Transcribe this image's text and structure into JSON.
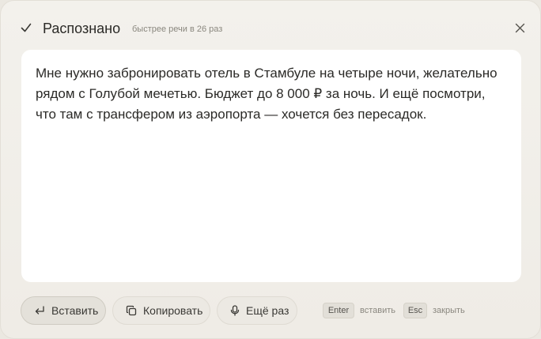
{
  "header": {
    "status_icon": "check-icon",
    "title": "Распознано",
    "subtitle": "быстрее речи в 26 раз",
    "close_icon": "close-icon"
  },
  "transcript": {
    "text": "Мне нужно забронировать отель в Стамбуле на четыре ночи, желательно рядом с Голубой мечетью. Бюджет до 8 000 ₽ за ночь. И ещё посмотри, что там с трансфером из аэропорта — хочется без пересадок."
  },
  "actions": {
    "insert": {
      "label": "Вставить",
      "icon": "enter-arrow-icon"
    },
    "copy": {
      "label": "Копировать",
      "icon": "copy-icon"
    },
    "retry": {
      "label": "Ещё раз",
      "icon": "microphone-icon"
    }
  },
  "shortcuts": {
    "enter_key": "Enter",
    "enter_hint": "вставить",
    "esc_key": "Esc",
    "esc_hint": "закрыть"
  },
  "colors": {
    "background": "#efece6",
    "text_area": "#ffffff",
    "text": "#2b2a27",
    "muted": "#8a877f"
  }
}
